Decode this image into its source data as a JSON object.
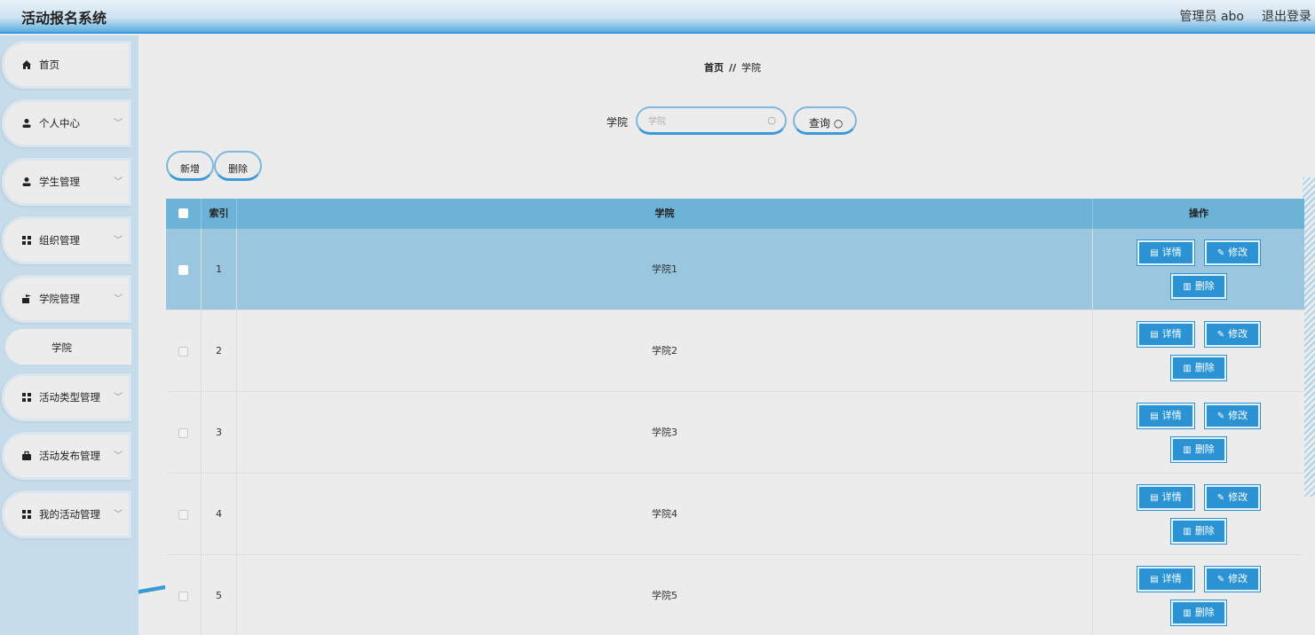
{
  "header": {
    "title": "活动报名系统",
    "admin": "管理员 abo",
    "logout": "退出登录"
  },
  "sidebar": {
    "items": [
      {
        "label": "首页",
        "icon": "home-icon",
        "chevron": false
      },
      {
        "label": "个人中心",
        "icon": "user-icon",
        "chevron": true
      },
      {
        "label": "学生管理",
        "icon": "user-icon",
        "chevron": true
      },
      {
        "label": "组织管理",
        "icon": "grid-icon",
        "chevron": true
      },
      {
        "label": "学院管理",
        "icon": "flag-icon",
        "chevron": true
      },
      {
        "label": "活动类型管理",
        "icon": "grid-icon",
        "chevron": true
      },
      {
        "label": "活动发布管理",
        "icon": "briefcase-icon",
        "chevron": true
      },
      {
        "label": "我的活动管理",
        "icon": "grid-icon",
        "chevron": true
      }
    ],
    "sub_item": "学院"
  },
  "breadcrumb": {
    "home": "首页",
    "sep": "//",
    "current": "学院"
  },
  "search": {
    "label": "学院",
    "placeholder": "学院",
    "button": "查询"
  },
  "toolbar": {
    "add": "新增",
    "delete": "删除"
  },
  "table": {
    "headers": {
      "index": "索引",
      "name": "学院",
      "ops": "操作"
    },
    "rows": [
      {
        "index": "1",
        "name": "学院1"
      },
      {
        "index": "2",
        "name": "学院2"
      },
      {
        "index": "3",
        "name": "学院3"
      },
      {
        "index": "4",
        "name": "学院4"
      },
      {
        "index": "5",
        "name": "学院5"
      }
    ],
    "selected_row": 1,
    "ops": {
      "detail": "详情",
      "edit": "修改",
      "delete": "删除"
    }
  },
  "colors": {
    "accent": "#2b93d3",
    "header_row": "#6db3d8",
    "selected_row": "#9ac7df",
    "sidebar": "#c7dceb"
  }
}
